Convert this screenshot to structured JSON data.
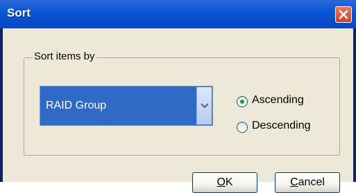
{
  "dialog": {
    "title": "Sort"
  },
  "groupbox": {
    "label": "Sort items by"
  },
  "combo": {
    "selected": "RAID Group"
  },
  "order": {
    "ascending_label": "Ascending",
    "descending_label": "Descending",
    "selected": "Ascending"
  },
  "buttons": {
    "ok_label": "OK",
    "cancel_label": "Cancel"
  },
  "colors": {
    "title_bar": "#0b55d6",
    "close_button": "#d2563c",
    "combo_selection": "#3169c6",
    "dialog_face": "#ece9d8"
  },
  "icons": {
    "close": "close-icon",
    "dropdown": "chevron-down-icon"
  }
}
